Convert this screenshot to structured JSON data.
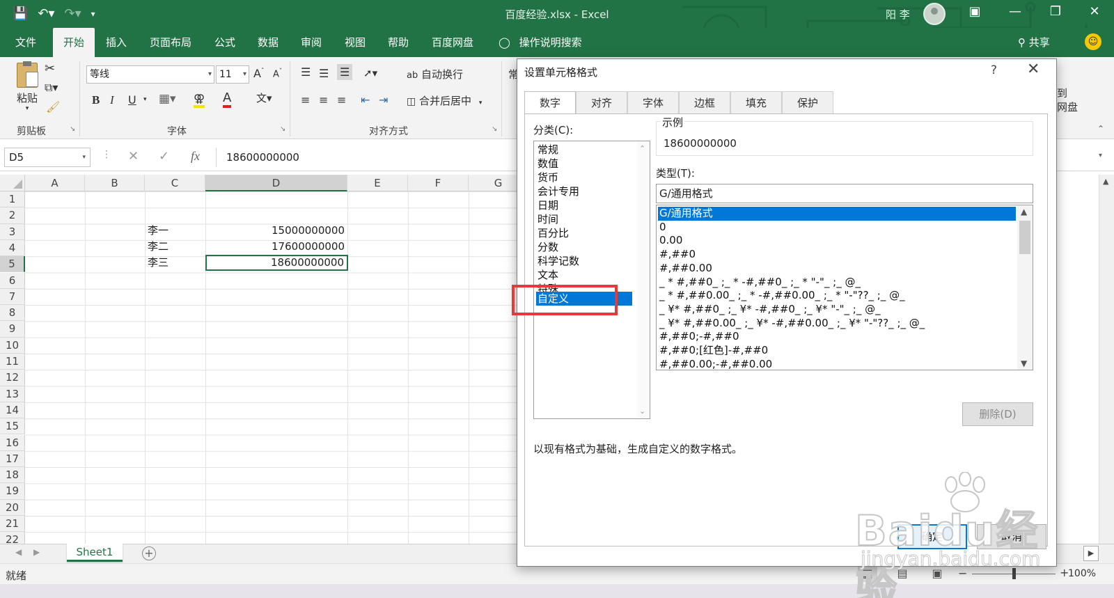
{
  "window": {
    "title": "百度经验.xlsx  -  Excel",
    "user": "阳 李",
    "colors": {
      "brand": "#217346",
      "selection": "#0078d7",
      "highlight": "#e53a3a"
    }
  },
  "menu": {
    "tabs": [
      "文件",
      "开始",
      "插入",
      "页面布局",
      "公式",
      "数据",
      "审阅",
      "视图",
      "帮助",
      "百度网盘"
    ],
    "active_tab": "开始",
    "search": "操作说明搜索",
    "share": "共享"
  },
  "ribbon": {
    "paste": "粘贴",
    "clipboard_label": "剪贴板",
    "font_name": "等线",
    "font_size": "11",
    "bold": "B",
    "italic": "I",
    "underline": "U",
    "font_label": "字体",
    "wrap_text": "自动换行",
    "merge_center": "合并后居中",
    "align_label": "对齐方式",
    "number_format_partial": "常",
    "baidu_save": "到\n网盘"
  },
  "formula_bar": {
    "name_box": "D5",
    "fx": "fx",
    "value": "18600000000"
  },
  "grid": {
    "columns": [
      "A",
      "B",
      "C",
      "D",
      "E",
      "F",
      "G"
    ],
    "selected_column": "D",
    "rows": [
      "1",
      "2",
      "3",
      "4",
      "5",
      "6",
      "7",
      "8",
      "9",
      "10",
      "11",
      "12",
      "13",
      "14",
      "15",
      "16",
      "17",
      "18",
      "19",
      "20",
      "21",
      "22"
    ],
    "selected_row": "5",
    "cells": [
      {
        "ref": "C3",
        "value": "李一"
      },
      {
        "ref": "D3",
        "value": "15000000000"
      },
      {
        "ref": "C4",
        "value": "李二"
      },
      {
        "ref": "D4",
        "value": "17600000000"
      },
      {
        "ref": "C5",
        "value": "李三"
      },
      {
        "ref": "D5",
        "value": "18600000000"
      }
    ]
  },
  "sheets": {
    "tabs": [
      "Sheet1"
    ],
    "active": "Sheet1"
  },
  "status": {
    "ready": "就绪",
    "zoom": "100%"
  },
  "dialog": {
    "title": "设置单元格格式",
    "help": "?",
    "tabs": [
      "数字",
      "对齐",
      "字体",
      "边框",
      "填充",
      "保护"
    ],
    "active_tab": "数字",
    "category_label": "分类(C):",
    "categories": [
      "常规",
      "数值",
      "货币",
      "会计专用",
      "日期",
      "时间",
      "百分比",
      "分数",
      "科学记数",
      "文本",
      "特殊",
      "自定义"
    ],
    "selected_category": "自定义",
    "sample_label": "示例",
    "sample_value": "18600000000",
    "type_label": "类型(T):",
    "type_value": "G/通用格式",
    "type_list": [
      "G/通用格式",
      "0",
      "0.00",
      "#,##0",
      "#,##0.00",
      "_ * #,##0_ ;_ * -#,##0_ ;_ * \"-\"_ ;_ @_",
      "_ * #,##0.00_ ;_ * -#,##0.00_ ;_ * \"-\"??_ ;_ @_",
      "_ ¥* #,##0_ ;_ ¥* -#,##0_ ;_ ¥* \"-\"_ ;_ @_",
      "_ ¥* #,##0.00_ ;_ ¥* -#,##0.00_ ;_ ¥* \"-\"??_ ;_ @_",
      "#,##0;-#,##0",
      "#,##0;[红色]-#,##0",
      "#,##0.00;-#,##0.00"
    ],
    "selected_type": "G/通用格式",
    "delete_button": "删除(D)",
    "description": "以现有格式为基础，生成自定义的数字格式。",
    "ok_button": "确定",
    "cancel_button": "取消"
  },
  "watermark": {
    "logo_text": "Baidu经验",
    "url": "jingyan.baidu.com"
  }
}
